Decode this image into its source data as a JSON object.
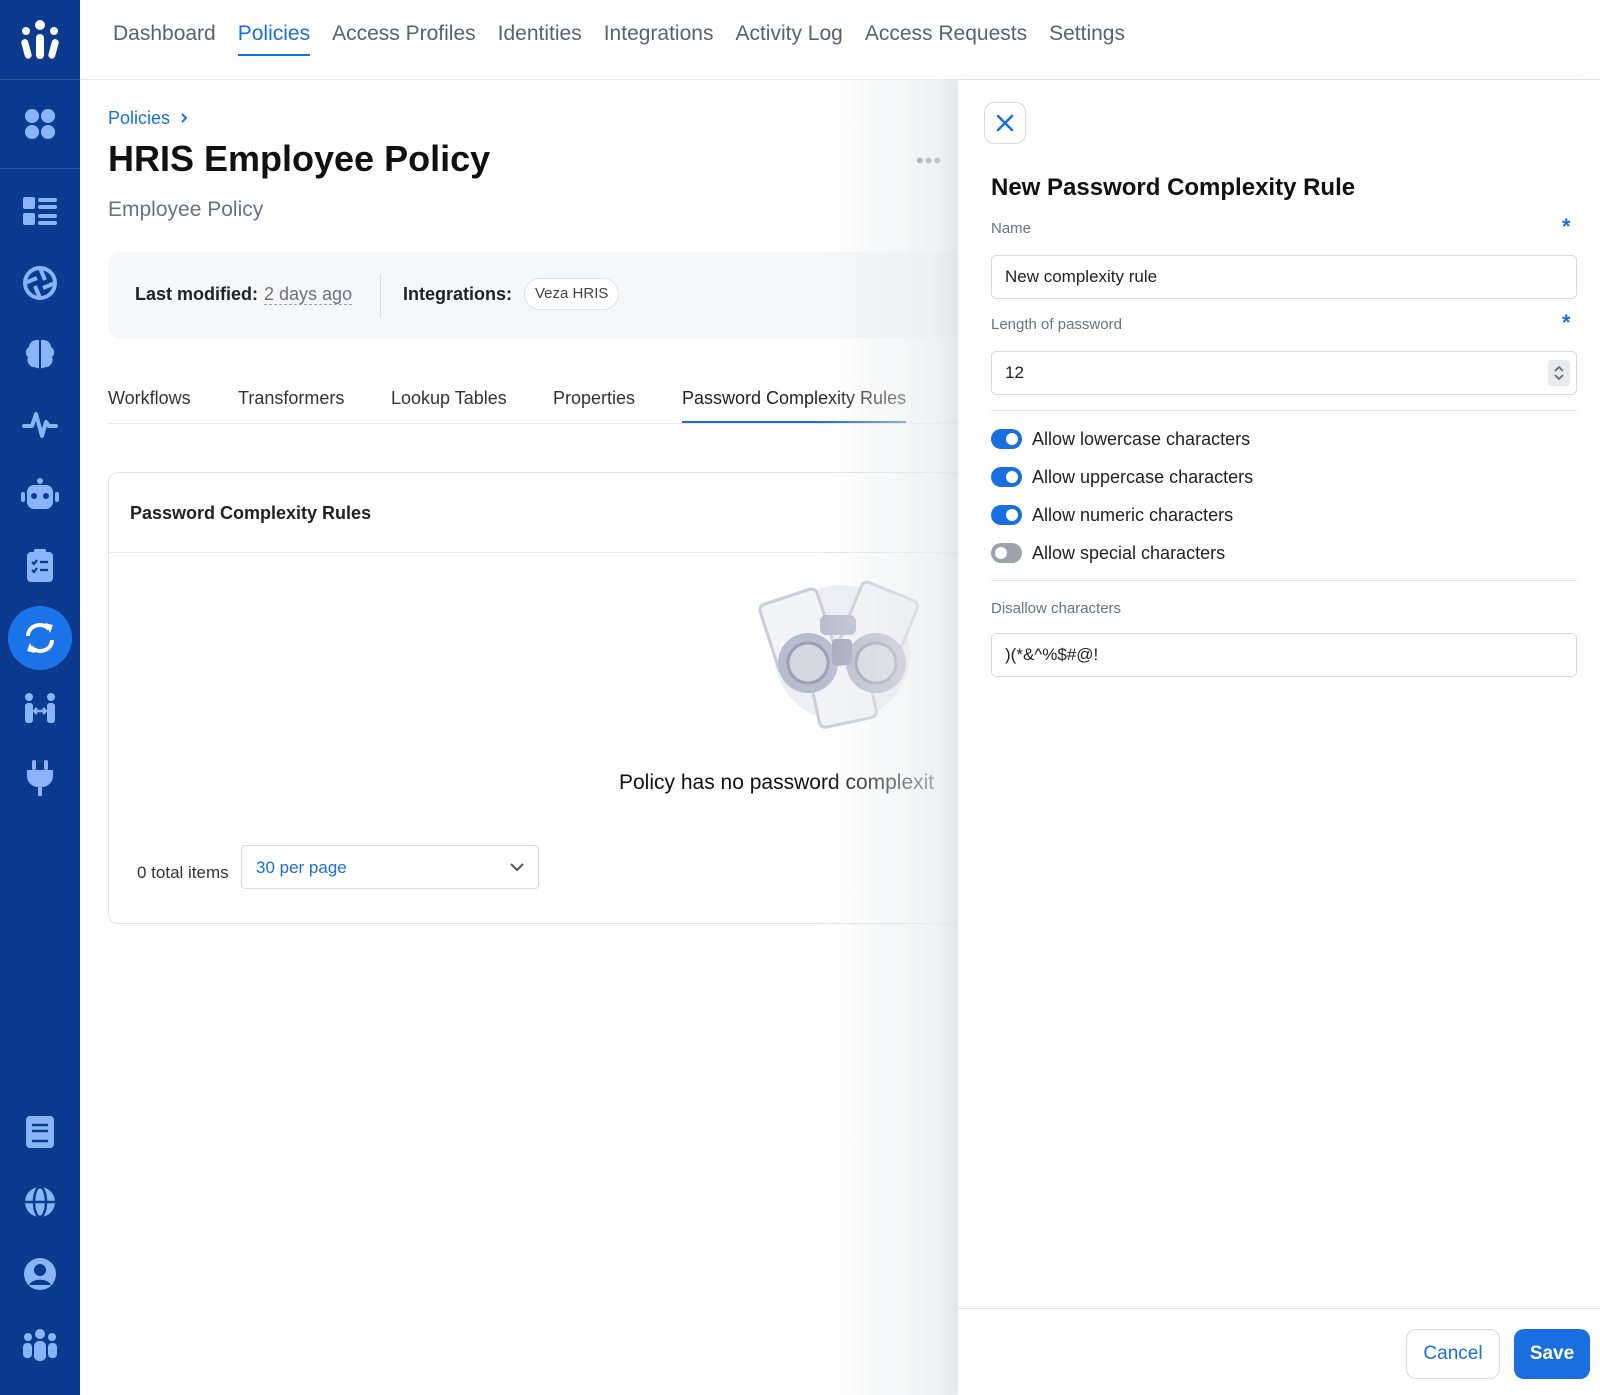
{
  "nav": {
    "items": [
      {
        "label": "Dashboard"
      },
      {
        "label": "Policies"
      },
      {
        "label": "Access Profiles"
      },
      {
        "label": "Identities"
      },
      {
        "label": "Integrations"
      },
      {
        "label": "Activity Log"
      },
      {
        "label": "Access Requests"
      },
      {
        "label": "Settings"
      }
    ],
    "active": "Policies"
  },
  "sidebar": {
    "icons": [
      "apps-icon",
      "dashboard-icon",
      "aperture-icon",
      "brain-icon",
      "activity-icon",
      "robot-icon",
      "clipboard-icon",
      "sync-icon",
      "team-access-icon",
      "plug-icon",
      "book-icon",
      "globe-icon",
      "user-icon",
      "team-icon"
    ],
    "active": "sync-icon"
  },
  "page": {
    "breadcrumb": "Policies",
    "title": "HRIS Employee Policy",
    "more": "•••",
    "subtitle": "Employee Policy",
    "last_modified_label": "Last modified:",
    "last_modified_value": "2 days ago",
    "integrations_label": "Integrations:",
    "integration_chip": "Veza HRIS",
    "tabs": [
      {
        "label": "Workflows"
      },
      {
        "label": "Transformers"
      },
      {
        "label": "Lookup Tables"
      },
      {
        "label": "Properties"
      },
      {
        "label": "Password Complexity Rules"
      }
    ],
    "active_tab": "Password Complexity Rules",
    "rules_card": {
      "title": "Password Complexity Rules",
      "empty_text": "Policy has no password complexit",
      "total_items": "0 total items",
      "per_page": "30 per page"
    }
  },
  "panel": {
    "title": "New Password Complexity Rule",
    "name_label": "Name",
    "name_value": "New complexity rule",
    "length_label": "Length of password",
    "length_value": "12",
    "required_mark": "*",
    "toggles": [
      {
        "label": "Allow lowercase characters",
        "on": true
      },
      {
        "label": "Allow uppercase characters",
        "on": true
      },
      {
        "label": "Allow numeric characters",
        "on": true
      },
      {
        "label": "Allow special characters",
        "on": false
      }
    ],
    "disallow_label": "Disallow characters",
    "disallow_value": ")(*&^%$#@!",
    "cancel_label": "Cancel",
    "save_label": "Save"
  },
  "colors": {
    "sidebar": "#0b3a8f",
    "accent": "#1a6fe0",
    "toggle_off": "#9ca3af"
  }
}
